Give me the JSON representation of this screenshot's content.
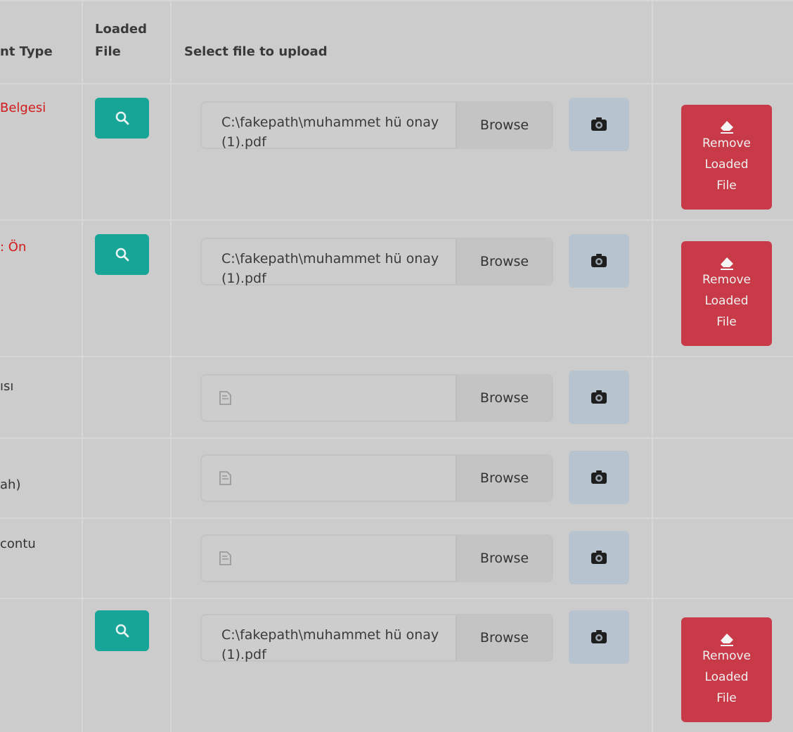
{
  "headers": {
    "document_type": "nt Type",
    "loaded_file_line1": "Loaded",
    "loaded_file_line2": "File",
    "select_file": "Select file to upload"
  },
  "rows": [
    {
      "type_label": "Belgesi",
      "type_color": "#d21b1b",
      "has_loaded": true,
      "file_value": "C:\\fakepath\\muhammet hü onay (1).pdf",
      "browse_label": "Browse",
      "remove_label_1": "Remove",
      "remove_label_2": "Loaded",
      "remove_label_3": "File"
    },
    {
      "type_label": ": Ön",
      "type_color": "#d21b1b",
      "has_loaded": true,
      "file_value": "C:\\fakepath\\muhammet hü onay (1).pdf",
      "browse_label": "Browse",
      "remove_label_1": "Remove",
      "remove_label_2": "Loaded",
      "remove_label_3": "File"
    },
    {
      "type_label": "ısı",
      "type_color": "#333333",
      "has_loaded": false,
      "file_value": "",
      "browse_label": "Browse"
    },
    {
      "type_label": "ah)",
      "type_color": "#333333",
      "has_loaded": false,
      "file_value": "",
      "browse_label": "Browse"
    },
    {
      "type_label": "contu",
      "type_color": "#333333",
      "has_loaded": false,
      "file_value": "",
      "browse_label": "Browse"
    },
    {
      "type_label": "",
      "type_color": "#333333",
      "has_loaded": true,
      "file_value": "C:\\fakepath\\muhammet hü onay (1).pdf",
      "browse_label": "Browse",
      "remove_label_1": "Remove",
      "remove_label_2": "Loaded",
      "remove_label_3": "File"
    }
  ],
  "icons": {
    "view": "search-icon",
    "camera": "camera-icon",
    "remove": "eraser-icon",
    "file_placeholder": "file-icon"
  },
  "colors": {
    "view_button": "#17a597",
    "remove_button": "#c83a48",
    "camera_button": "#b8c3d0"
  }
}
